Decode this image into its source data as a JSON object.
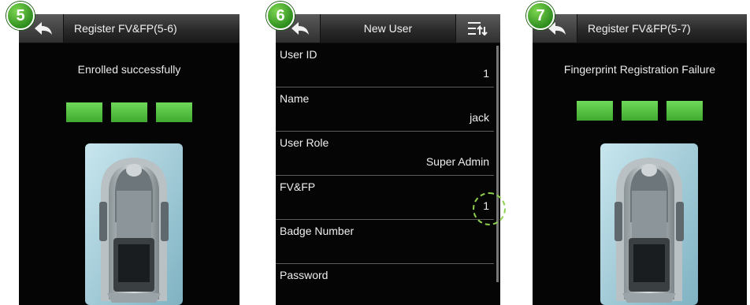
{
  "panels": {
    "step5": {
      "badge": "5",
      "title": "Register FV&FP(5-6)",
      "message": "Enrolled successfully",
      "progress_segments": 3
    },
    "step6": {
      "badge": "6",
      "title": "New User",
      "rows": [
        {
          "label": "User ID",
          "value": "1"
        },
        {
          "label": "Name",
          "value": "jack"
        },
        {
          "label": "User Role",
          "value": "Super Admin"
        },
        {
          "label": "FV&FP",
          "value": "1"
        },
        {
          "label": "Badge Number",
          "value": ""
        },
        {
          "label": "Password",
          "value": ""
        }
      ]
    },
    "step7": {
      "badge": "7",
      "title": "Register FV&FP(5-7)",
      "message": "Fingerprint Registration Failure",
      "progress_segments": 3
    }
  },
  "icons": {
    "back": "back-arrow-icon",
    "menu": "sort-menu-icon",
    "scanner": "fingerprint-scanner-icon"
  },
  "colors": {
    "progress_green": "#4cc23a",
    "badge_green": "#3a9a26",
    "highlight_ring": "#8fd14f"
  }
}
